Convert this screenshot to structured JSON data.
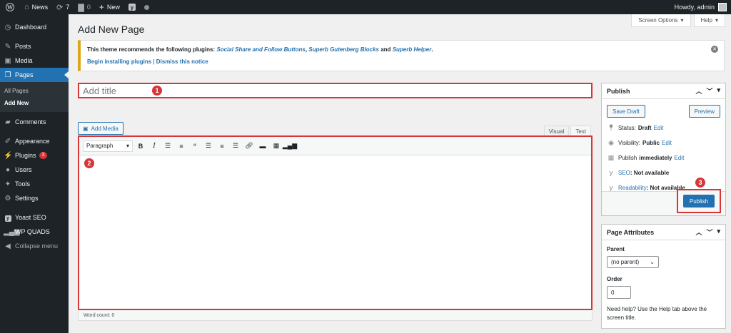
{
  "adminbar": {
    "site_name": "News",
    "updates_count": "7",
    "comments_count": "0",
    "new_label": "New",
    "greeting": "Howdy, admin"
  },
  "sidebar": {
    "items": [
      {
        "label": "Dashboard",
        "icon": "dashboard-icon"
      },
      {
        "label": "Posts",
        "icon": "pin-icon"
      },
      {
        "label": "Media",
        "icon": "media-icon"
      },
      {
        "label": "Pages",
        "icon": "pages-icon"
      },
      {
        "label": "Comments",
        "icon": "comment-icon"
      },
      {
        "label": "Appearance",
        "icon": "brush-icon"
      },
      {
        "label": "Plugins",
        "icon": "plug-icon",
        "badge": "3"
      },
      {
        "label": "Users",
        "icon": "user-icon"
      },
      {
        "label": "Tools",
        "icon": "wrench-icon"
      },
      {
        "label": "Settings",
        "icon": "settings-icon"
      },
      {
        "label": "Yoast SEO",
        "icon": "yoast-icon"
      },
      {
        "label": "WP QUADS",
        "icon": "signal-icon"
      },
      {
        "label": "Collapse menu",
        "icon": "collapse-icon"
      }
    ],
    "submenu": [
      "All Pages",
      "Add New"
    ]
  },
  "header": {
    "title": "Add New Page",
    "screen_options": "Screen Options",
    "help": "Help"
  },
  "notice": {
    "text_before": "This theme recommends the following plugins:",
    "plugin1": "Social Share and Follow Buttons",
    "sep1": ",",
    "plugin2": "Superb Gutenberg Blocks",
    "and": "and",
    "plugin3": "Superb Helper",
    "end": ".",
    "begin_link": "Begin installing plugins",
    "pipe": "|",
    "dismiss_link": "Dismiss this notice"
  },
  "editor": {
    "title_placeholder": "Add title",
    "add_media": "Add Media",
    "tab_visual": "Visual",
    "tab_text": "Text",
    "format": "Paragraph",
    "word_count": "Word count: 0"
  },
  "badges": {
    "one": "1",
    "two": "2",
    "three": "3"
  },
  "publish": {
    "heading": "Publish",
    "save_draft": "Save Draft",
    "preview": "Preview",
    "status_label": "Status:",
    "status_value": "Draft",
    "edit": "Edit",
    "visibility_label": "Visibility:",
    "visibility_value": "Public",
    "publish_label": "Publish",
    "publish_value": "immediately",
    "seo_link": "SEO",
    "seo_value": ": Not available",
    "readability_link": "Readability",
    "readability_value": ": Not available",
    "publish_button": "Publish"
  },
  "attributes": {
    "heading": "Page Attributes",
    "parent_label": "Parent",
    "parent_value": "(no parent)",
    "order_label": "Order",
    "order_value": "0",
    "help_text": "Need help? Use the Help tab above the screen title."
  },
  "colors": {
    "accent": "#2271b1",
    "highlight": "#d63638",
    "sidebar": "#1d2327"
  }
}
